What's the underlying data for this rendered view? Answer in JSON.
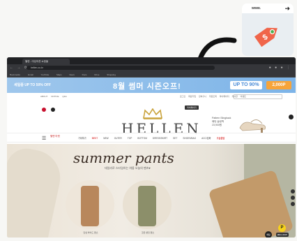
{
  "extension": {
    "url": "www.",
    "icon": "price-tag-icon",
    "tag_color": "#f0654a"
  },
  "browser": {
    "tab_title": "헬렌 - 여성의류 쇼핑몰",
    "address": "hellen.co.kr",
    "bookmarks": [
      "Bookmarks",
      "Gmail",
      "YouTube",
      "Maps",
      "News",
      "Docs",
      "Drive",
      "Shopping"
    ]
  },
  "promo": {
    "left_text": "세일중 UP TO 50% OFF",
    "center_text": "8월 썸머 시즌오프!",
    "right_box": "UP TO 90%",
    "right_box2": "2,000P"
  },
  "utility": {
    "left_links": [
      "ABOUT",
      "NOTICE",
      "Q&A"
    ],
    "right_links": [
      "로그인",
      "회원가입",
      "장바구니",
      "주문조회",
      "마이페이지",
      "게시판",
      "이벤트"
    ]
  },
  "tooltip": "마이페이지",
  "logo": "HELLEN",
  "shoe_ad": {
    "line1": "Pattern Slingback",
    "line2": "패턴 슬링백",
    "line3": "23,900원"
  },
  "nav": {
    "brand_chip": "헬렌\n마켓",
    "items": [
      {
        "label": "기획특가",
        "hot": false
      },
      {
        "label": "BEST",
        "hot": true
      },
      {
        "label": "NEW",
        "hot": false
      },
      {
        "label": "OUTER",
        "hot": false
      },
      {
        "label": "TOP",
        "hot": false
      },
      {
        "label": "BOTTOM",
        "hot": false
      },
      {
        "label": "DRESS/SKIRT",
        "hot": false
      },
      {
        "label": "SET",
        "hot": false
      },
      {
        "label": "SHOES/BAG",
        "hot": false
      },
      {
        "label": "ACC/잡화",
        "hot": false
      },
      {
        "label": "오늘출발",
        "hot": true
      }
    ]
  },
  "hero": {
    "title": "summer pants",
    "subtitle": "데일리로 스타일하는 여름 오늘의 팬츠♥",
    "caption1": "린넨 와이드 팬츠",
    "caption2": "코튼 밴딩 팬츠"
  },
  "pay_badge": {
    "letter": "P",
    "amount": "₩10,000P"
  },
  "chat_label": "채팅"
}
